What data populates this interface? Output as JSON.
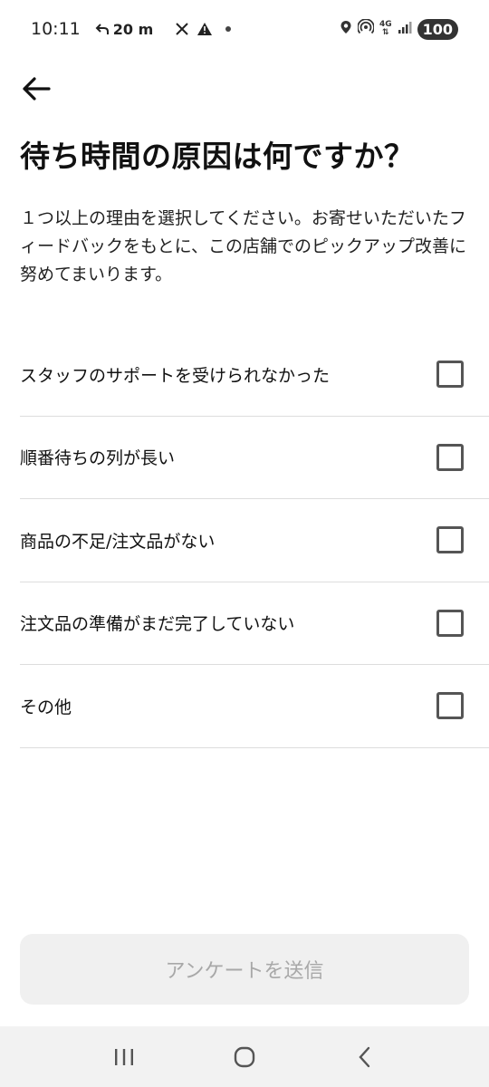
{
  "status_bar": {
    "time": "10:11",
    "call_duration": "20 m",
    "network": "4G",
    "battery": "100"
  },
  "header": {
    "back_icon": "arrow-left-icon",
    "title": "待ち時間の原因は何ですか？",
    "description": "１つ以上の理由を選択してください。お寄せいただいたフィードバックをもとに、この店舗でのピックアップ改善に努めてまいります。"
  },
  "options": [
    {
      "label": "スタッフのサポートを受けられなかった",
      "checked": false
    },
    {
      "label": "順番待ちの列が長い",
      "checked": false
    },
    {
      "label": "商品の不足/注文品がない",
      "checked": false
    },
    {
      "label": "注文品の準備がまだ完了していない",
      "checked": false
    },
    {
      "label": "その他",
      "checked": false
    }
  ],
  "submit": {
    "label": "アンケートを送信",
    "enabled": false
  },
  "nav": {
    "recents": "recents-icon",
    "home": "home-icon",
    "back": "back-icon"
  }
}
